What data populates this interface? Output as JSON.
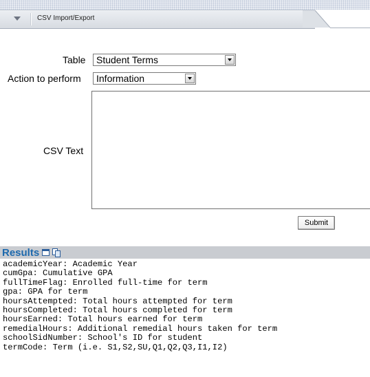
{
  "panel": {
    "title": "CSV Import/Export"
  },
  "form": {
    "table_label": "Table",
    "table_value": "Student Terms",
    "action_label": "Action to perform",
    "action_value": "Information",
    "csv_label": "CSV Text",
    "csv_value": "",
    "submit_label": "Submit"
  },
  "results": {
    "title": "Results",
    "lines": [
      "academicYear: Academic Year",
      "cumGpa: Cumulative GPA",
      "fullTimeFlag: Enrolled full-time for term",
      "gpa: GPA for term",
      "hoursAttempted: Total hours attempted for term",
      "hoursCompleted: Total hours completed for term",
      "hoursEarned: Total hours earned for term",
      "remedialHours: Additional remedial hours taken for term",
      "schoolSidNumber: School's ID for student",
      "termCode: Term (i.e. S1,S2,SU,Q1,Q2,Q3,I1,I2)"
    ]
  },
  "colors": {
    "results_title": "#1d69ad",
    "results_bar": "#c9ccd1"
  },
  "icons": {
    "collapse": "triangle-down-icon",
    "window": "window-icon",
    "copy": "copy-icon"
  }
}
